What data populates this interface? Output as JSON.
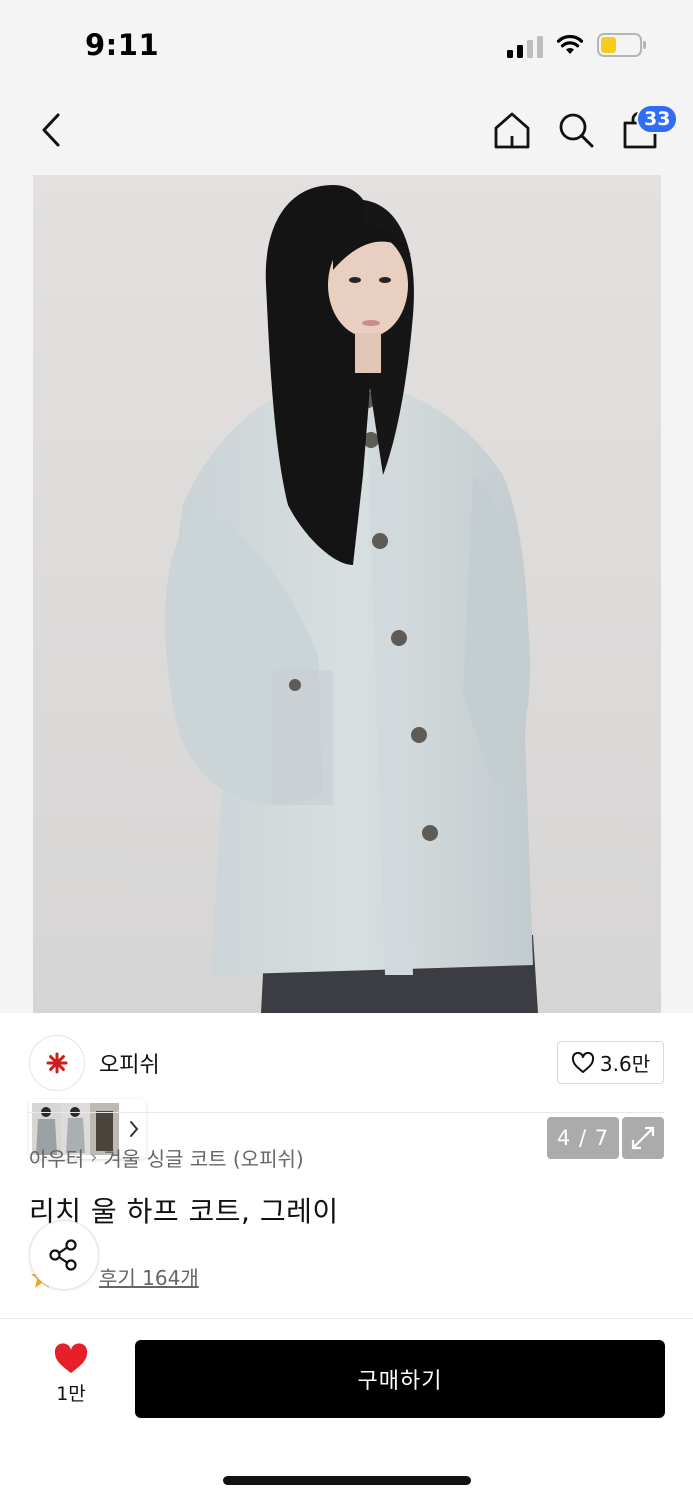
{
  "status_bar": {
    "time": "9:11"
  },
  "nav": {
    "cart_count": "33"
  },
  "gallery": {
    "counter": "4 / 7"
  },
  "brand": {
    "name": "오피쉬",
    "likes": "3.6만"
  },
  "product": {
    "breadcrumb": [
      "아우터",
      "겨울 싱글 코트 (오피쉬)"
    ],
    "title": "리치 울 하프 코트, 그레이",
    "review_link": "후기 164개"
  },
  "bottom_bar": {
    "wish_count": "1만",
    "buy_label": "구매하기"
  },
  "colors": {
    "accent_blue": "#2f6df6",
    "heart_red": "#e61f2b",
    "buy_button": "#000000",
    "star": "#f5a623"
  },
  "icons": [
    "back-icon",
    "home-icon",
    "search-icon",
    "cart-icon",
    "chevron-right-icon",
    "expand-icon",
    "heart-outline-icon",
    "share-icon",
    "star-icon",
    "heart-filled-icon"
  ]
}
